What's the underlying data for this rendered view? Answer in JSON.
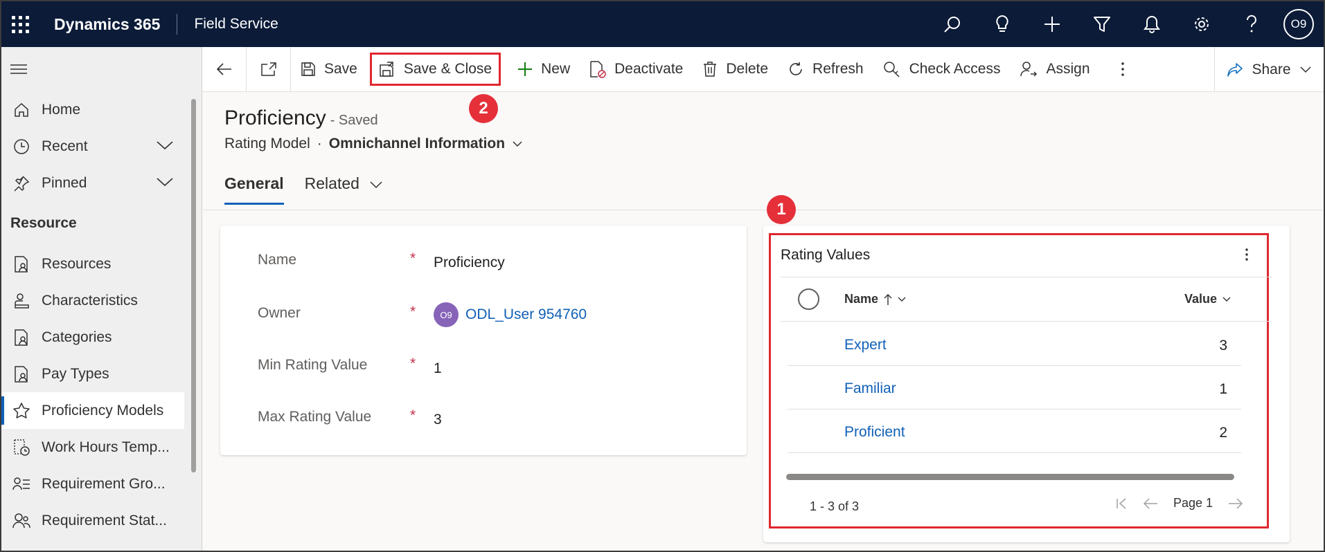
{
  "topbar": {
    "brand": "Dynamics 365",
    "app_name": "Field Service",
    "user_initials": "O9",
    "icons": [
      "search-icon",
      "lightbulb-icon",
      "plus-icon",
      "filter-icon",
      "bell-icon",
      "gear-icon",
      "help-icon"
    ]
  },
  "sidebar": {
    "items_top": [
      {
        "label": "Home",
        "icon": "home-icon"
      },
      {
        "label": "Recent",
        "icon": "clock-icon"
      },
      {
        "label": "Pinned",
        "icon": "pin-icon"
      }
    ],
    "group_label": "Resource",
    "items": [
      {
        "label": "Resources",
        "icon": "document-person-icon"
      },
      {
        "label": "Characteristics",
        "icon": "person-desk-icon"
      },
      {
        "label": "Categories",
        "icon": "document-person-icon"
      },
      {
        "label": "Pay Types",
        "icon": "document-person-icon"
      },
      {
        "label": "Proficiency Models",
        "icon": "star-icon",
        "selected": true
      },
      {
        "label": "Work Hours Temp...",
        "icon": "calendar-clock-icon"
      },
      {
        "label": "Requirement Gro...",
        "icon": "person-list-icon"
      },
      {
        "label": "Requirement Stat...",
        "icon": "people-icon"
      }
    ]
  },
  "commandbar": {
    "save": "Save",
    "save_close": "Save & Close",
    "new": "New",
    "deactivate": "Deactivate",
    "delete": "Delete",
    "refresh": "Refresh",
    "check_access": "Check Access",
    "assign": "Assign",
    "share": "Share"
  },
  "badges": {
    "one": "1",
    "two": "2"
  },
  "record": {
    "title": "Proficiency",
    "status": "- Saved",
    "entity": "Rating Model",
    "separator": "·",
    "form_name": "Omnichannel Information"
  },
  "tabs": {
    "general": "General",
    "related": "Related"
  },
  "general": {
    "name_label": "Name",
    "name_value": "Proficiency",
    "owner_label": "Owner",
    "owner_initials": "O9",
    "owner_value": "ODL_User 954760",
    "min_label": "Min Rating Value",
    "min_value": "1",
    "max_label": "Max Rating Value",
    "max_value": "3",
    "required_mark": "*"
  },
  "rating_values": {
    "title": "Rating Values",
    "col_name": "Name",
    "col_value": "Value",
    "rows": [
      {
        "name": "Expert",
        "value": "3"
      },
      {
        "name": "Familiar",
        "value": "1"
      },
      {
        "name": "Proficient",
        "value": "2"
      }
    ],
    "count": "1 - 3 of 3",
    "page": "Page 1"
  }
}
